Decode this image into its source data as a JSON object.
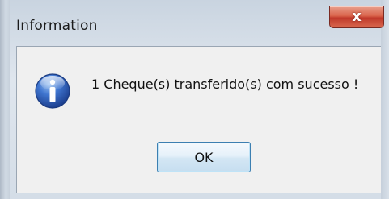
{
  "window": {
    "title": "Information",
    "close_glyph": "x"
  },
  "dialog": {
    "icon": "information-icon",
    "message": "1 Cheque(s) transferido(s) com sucesso !",
    "ok_label": "OK"
  },
  "colors": {
    "close_button": "#c0392b",
    "icon_blue": "#2f5fb3",
    "ok_border": "#3c7fb1"
  }
}
